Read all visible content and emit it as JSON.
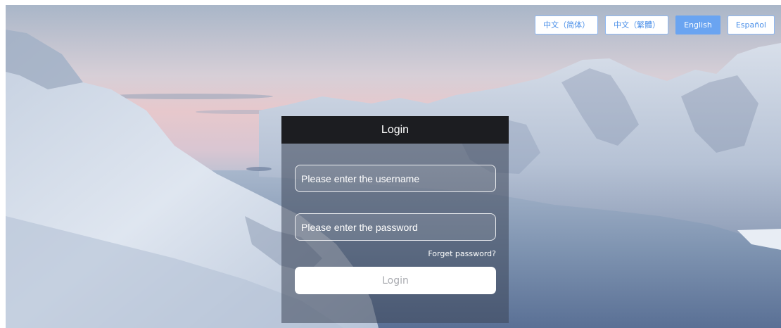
{
  "languages": [
    {
      "label": "中文（简体）",
      "active": false
    },
    {
      "label": "中文（繁體）",
      "active": false
    },
    {
      "label": "English",
      "active": true
    },
    {
      "label": "Español",
      "active": false
    }
  ],
  "login": {
    "title": "Login",
    "username_placeholder": "Please enter the username",
    "password_placeholder": "Please enter the password",
    "forgot_label": "Forget password?",
    "submit_label": "Login"
  },
  "colors": {
    "accent": "#6aa4f1",
    "panel_header": "#1c1d21",
    "button_text": "#a9abb0"
  }
}
